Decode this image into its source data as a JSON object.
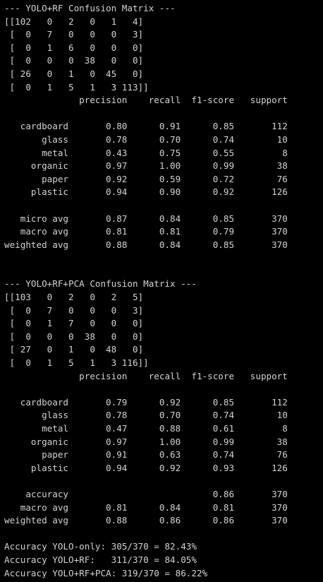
{
  "terminal": {
    "lines": [
      "--- YOLO+RF Confusion Matrix ---",
      "[[102   0   2   0   1   4]",
      " [  0   7   0   0   0   3]",
      " [  0   1   6   0   0   0]",
      " [  0   0   0  38   0   0]",
      " [ 26   0   1   0  45   0]",
      " [  0   1   5   1   3 113]]",
      "              precision    recall  f1-score   support",
      "",
      "   cardboard       0.80      0.91      0.85       112",
      "       glass       0.78      0.70      0.74        10",
      "       metal       0.43      0.75      0.55         8",
      "     organic       0.97      1.00      0.99        38",
      "       paper       0.92      0.59      0.72        76",
      "     plastic       0.94      0.90      0.92       126",
      "",
      "   micro avg       0.87      0.84      0.85       370",
      "   macro avg       0.81      0.81      0.79       370",
      "weighted avg       0.88      0.84      0.85       370",
      "",
      "",
      "--- YOLO+RF+PCA Confusion Matrix ---",
      "[[103   0   2   0   2   5]",
      " [  0   7   0   0   0   3]",
      " [  0   1   7   0   0   0]",
      " [  0   0   0  38   0   0]",
      " [ 27   0   1   0  48   0]",
      " [  0   1   5   1   3 116]]",
      "              precision    recall  f1-score   support",
      "",
      "   cardboard       0.79      0.92      0.85       112",
      "       glass       0.78      0.70      0.74        10",
      "       metal       0.47      0.88      0.61         8",
      "     organic       0.97      1.00      0.99        38",
      "       paper       0.91      0.63      0.74        76",
      "     plastic       0.94      0.92      0.93       126",
      "",
      "    accuracy                           0.86       370",
      "   macro avg       0.81      0.84      0.81       370",
      "weighted avg       0.88      0.86      0.86       370",
      "",
      "Accuracy YOLO-only: 305/370 = 82.43%",
      "Accuracy YOLO+RF:   311/370 = 84.05%",
      "Accuracy YOLO+RF+PCA: 319/370 = 86.22%"
    ]
  }
}
